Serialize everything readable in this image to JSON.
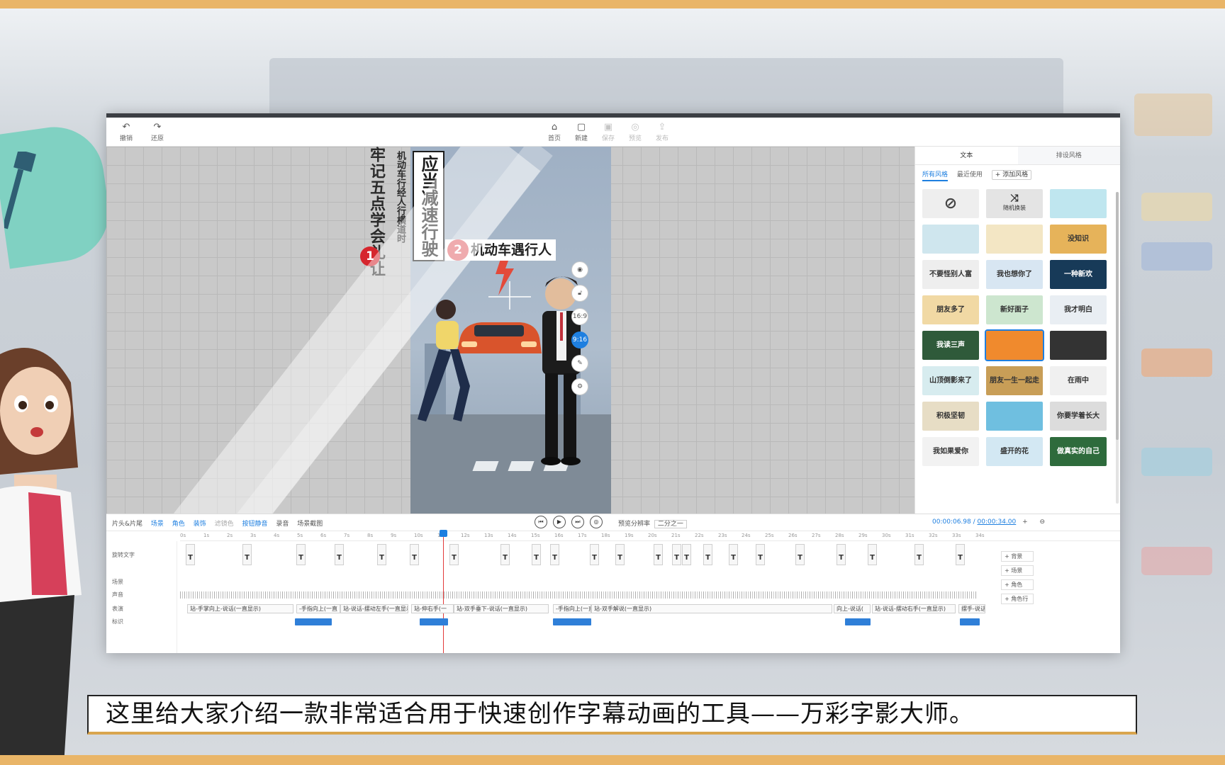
{
  "toolbar": {
    "undo": "撤销",
    "redo": "还原",
    "home": "首页",
    "new": "新建",
    "save": "保存",
    "preview": "预览",
    "publish": "发布"
  },
  "stage": {
    "vertical_title_1": "牢记五点学会礼让",
    "vertical_title_2": "机动车行经人行横道时",
    "vertical_title_3": "应当减速行驶",
    "badge_1": "1",
    "badge_2": "2",
    "heading_2": "机动车遇行人",
    "ratio_16_9": "16:9",
    "ratio_9_16": "9:16"
  },
  "panel": {
    "tab_text": "文本",
    "tab_style": "排设风格",
    "sub_all": "所有风格",
    "sub_recent": "最近使用",
    "sub_add": "+ 添加风格",
    "random": "随机换装",
    "thumbs": [
      {
        "text": "",
        "color": "#eeeeee"
      },
      {
        "text": "",
        "color": "#e4e4e4"
      },
      {
        "text": "",
        "color": "#bfe6ef"
      },
      {
        "text": "",
        "color": "#cfe6ee"
      },
      {
        "text": "",
        "color": "#f3e6c4"
      },
      {
        "text": "没知识",
        "color": "#e6b35a"
      },
      {
        "text": "不要怪别人富",
        "color": "#eeeeee"
      },
      {
        "text": "我也想你了",
        "color": "#d8e6f2"
      },
      {
        "text": "一种新欢",
        "color": "#173a58"
      },
      {
        "text": "朋友多了",
        "color": "#f1d9a4"
      },
      {
        "text": "新好面子",
        "color": "#cde6cf"
      },
      {
        "text": "我才明白",
        "color": "#e9eef3"
      },
      {
        "text": "我读三声",
        "color": "#2f5a3a"
      },
      {
        "text": "",
        "color": "#f08a2d"
      },
      {
        "text": "",
        "color": "#333333"
      },
      {
        "text": "山顶倒影来了",
        "color": "#d7ecef"
      },
      {
        "text": "朋友一生一起走",
        "color": "#c89e57"
      },
      {
        "text": "在雨中",
        "color": "#f0f0f0"
      },
      {
        "text": "积极坚韧",
        "color": "#e7ddc5"
      },
      {
        "text": "",
        "color": "#6fbfe0"
      },
      {
        "text": "你要学着长大",
        "color": "#dcdcdc"
      },
      {
        "text": "我如果爱你",
        "color": "#f2f2f2"
      },
      {
        "text": "盛开的花",
        "color": "#d3e8f3"
      },
      {
        "text": "做真实的自己",
        "color": "#2e6b3c"
      }
    ]
  },
  "timeline": {
    "tabs": [
      "片头&片尾",
      "场景",
      "角色",
      "装饰",
      "滤镜色",
      "按钮静音",
      "录音",
      "场景截图"
    ],
    "ratio_label": "预览分辨率",
    "ratio_value": "二分之一",
    "current_time": "00:00:06.98",
    "total_time": "00:00:34.00",
    "ruler": [
      "0s",
      "1s",
      "2s",
      "3s",
      "4s",
      "5s",
      "6s",
      "7s",
      "8s",
      "9s",
      "10s",
      "11s",
      "12s",
      "13s",
      "14s",
      "15s",
      "16s",
      "17s",
      "18s",
      "19s",
      "20s",
      "21s",
      "22s",
      "23s",
      "24s",
      "25s",
      "26s",
      "27s",
      "28s",
      "29s",
      "30s",
      "31s",
      "32s",
      "33s",
      "34s"
    ],
    "track_labels": [
      "旋转文字",
      "场景",
      "声音",
      "表演",
      "标识"
    ],
    "action_clips": [
      "站-手掌向上-说话(一直显示)",
      "-手指向上(一直",
      "站-说话-摆动左手(一直显示",
      "站-伸右手(一",
      "站-双手垂下-说话(一直显示)",
      "-手指向上(一直",
      "站-双手解说(一直显示)",
      "向上-说话(",
      "站-说话-摆动右手(一直显示)",
      "摆手-说话"
    ],
    "right_actions": [
      "+ 背景",
      "+ 场景",
      "+ 角色",
      "+ 角色行"
    ]
  },
  "subtitle": "这里给大家介绍一款非常适合用于快速创作字幕动画的工具——万彩字影大师。"
}
